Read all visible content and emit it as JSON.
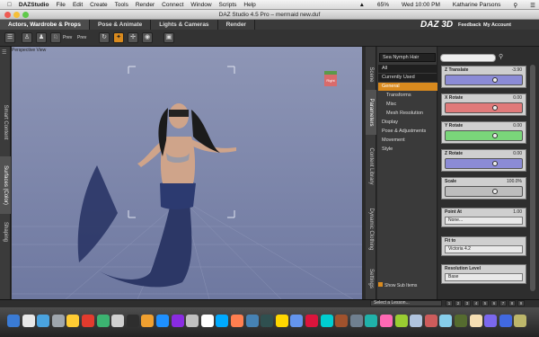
{
  "menubar": {
    "items": [
      "DAZStudio",
      "File",
      "Edit",
      "Create",
      "Tools",
      "Render",
      "Connect",
      "Window",
      "Scripts",
      "Help"
    ],
    "battery": "65%",
    "date_time": "Wed 10:00 PM",
    "user": "Katharine Parsons"
  },
  "window": {
    "title": "DAZ Studio 4.5 Pro – mermaid new.duf"
  },
  "header": {
    "tabs": [
      "Actors, Wardrobe & Props",
      "Pose & Animate",
      "Lights & Cameras",
      "Render"
    ],
    "active_tab": "Actors, Wardrobe & Props",
    "logo": "DAZ 3D",
    "feedback": "Feedback",
    "my_account": "My Account",
    "tool_labels": [
      "Prev",
      "Prev"
    ]
  },
  "left_tabs": [
    "Smart Content",
    "Surfaces (Color)",
    "Shaping"
  ],
  "left_active": "Surfaces (Color)",
  "right_tabs": [
    "Scene",
    "Parameters",
    "Content Library",
    "Dynamic Clothing",
    "Settings"
  ],
  "right_active": "Parameters",
  "viewport": {
    "camera_label": "Perspective View",
    "cube_face": "Right"
  },
  "parameters": {
    "node": "Sea Nymph Hair",
    "tree": [
      "All",
      "Currently Used",
      "General",
      "Transforms",
      "Misc",
      "Mesh Resolution",
      "Display",
      "Pose & Adjustments",
      "Movement",
      "Style"
    ],
    "selected": "General",
    "show_sub_items": "Show Sub Items",
    "cards": [
      {
        "title": "Z Translate",
        "value": "-3.90",
        "color": "#8b8bd6"
      },
      {
        "title": "X Rotate",
        "value": "0.00",
        "color": "#e07a7a"
      },
      {
        "title": "Y Rotate",
        "value": "0.00",
        "color": "#7ad67a"
      },
      {
        "title": "Z Rotate",
        "value": "0.00",
        "color": "#8b8bd6"
      },
      {
        "title": "Scale",
        "value": "100.0%",
        "color": "#cfcfcf"
      }
    ],
    "point_at": {
      "title": "Point At",
      "value": "1.00",
      "option": "None..."
    },
    "fit_to": {
      "title": "Fit to",
      "option": "Victoria 4.2"
    },
    "resolution": {
      "title": "Resolution Level",
      "option": "Base"
    }
  },
  "lesson": {
    "placeholder": "Select a Lesson...",
    "pages": [
      "1",
      "2",
      "3",
      "4",
      "5",
      "6",
      "7",
      "8",
      "9"
    ]
  },
  "dock_colors": [
    "#3a7bd5",
    "#e8e8e8",
    "#4aa3df",
    "#9fa6ad",
    "#ffcc33",
    "#e33b2e",
    "#3cb371",
    "#d0d0d0",
    "#2e2e2e",
    "#f0a030",
    "#1e90ff",
    "#8a2be2",
    "#c0c0c0",
    "#ffffff",
    "#00aaff",
    "#ff7f50",
    "#4682b4",
    "#2f4f4f",
    "#ffd700",
    "#6495ed",
    "#dc143c",
    "#00ced1",
    "#a0522d",
    "#708090",
    "#20b2aa",
    "#ff69b4",
    "#9acd32",
    "#b0c4de",
    "#cd5c5c",
    "#87ceeb",
    "#556b2f",
    "#f5deb3",
    "#7b68ee",
    "#4169e1",
    "#bdb76b"
  ]
}
